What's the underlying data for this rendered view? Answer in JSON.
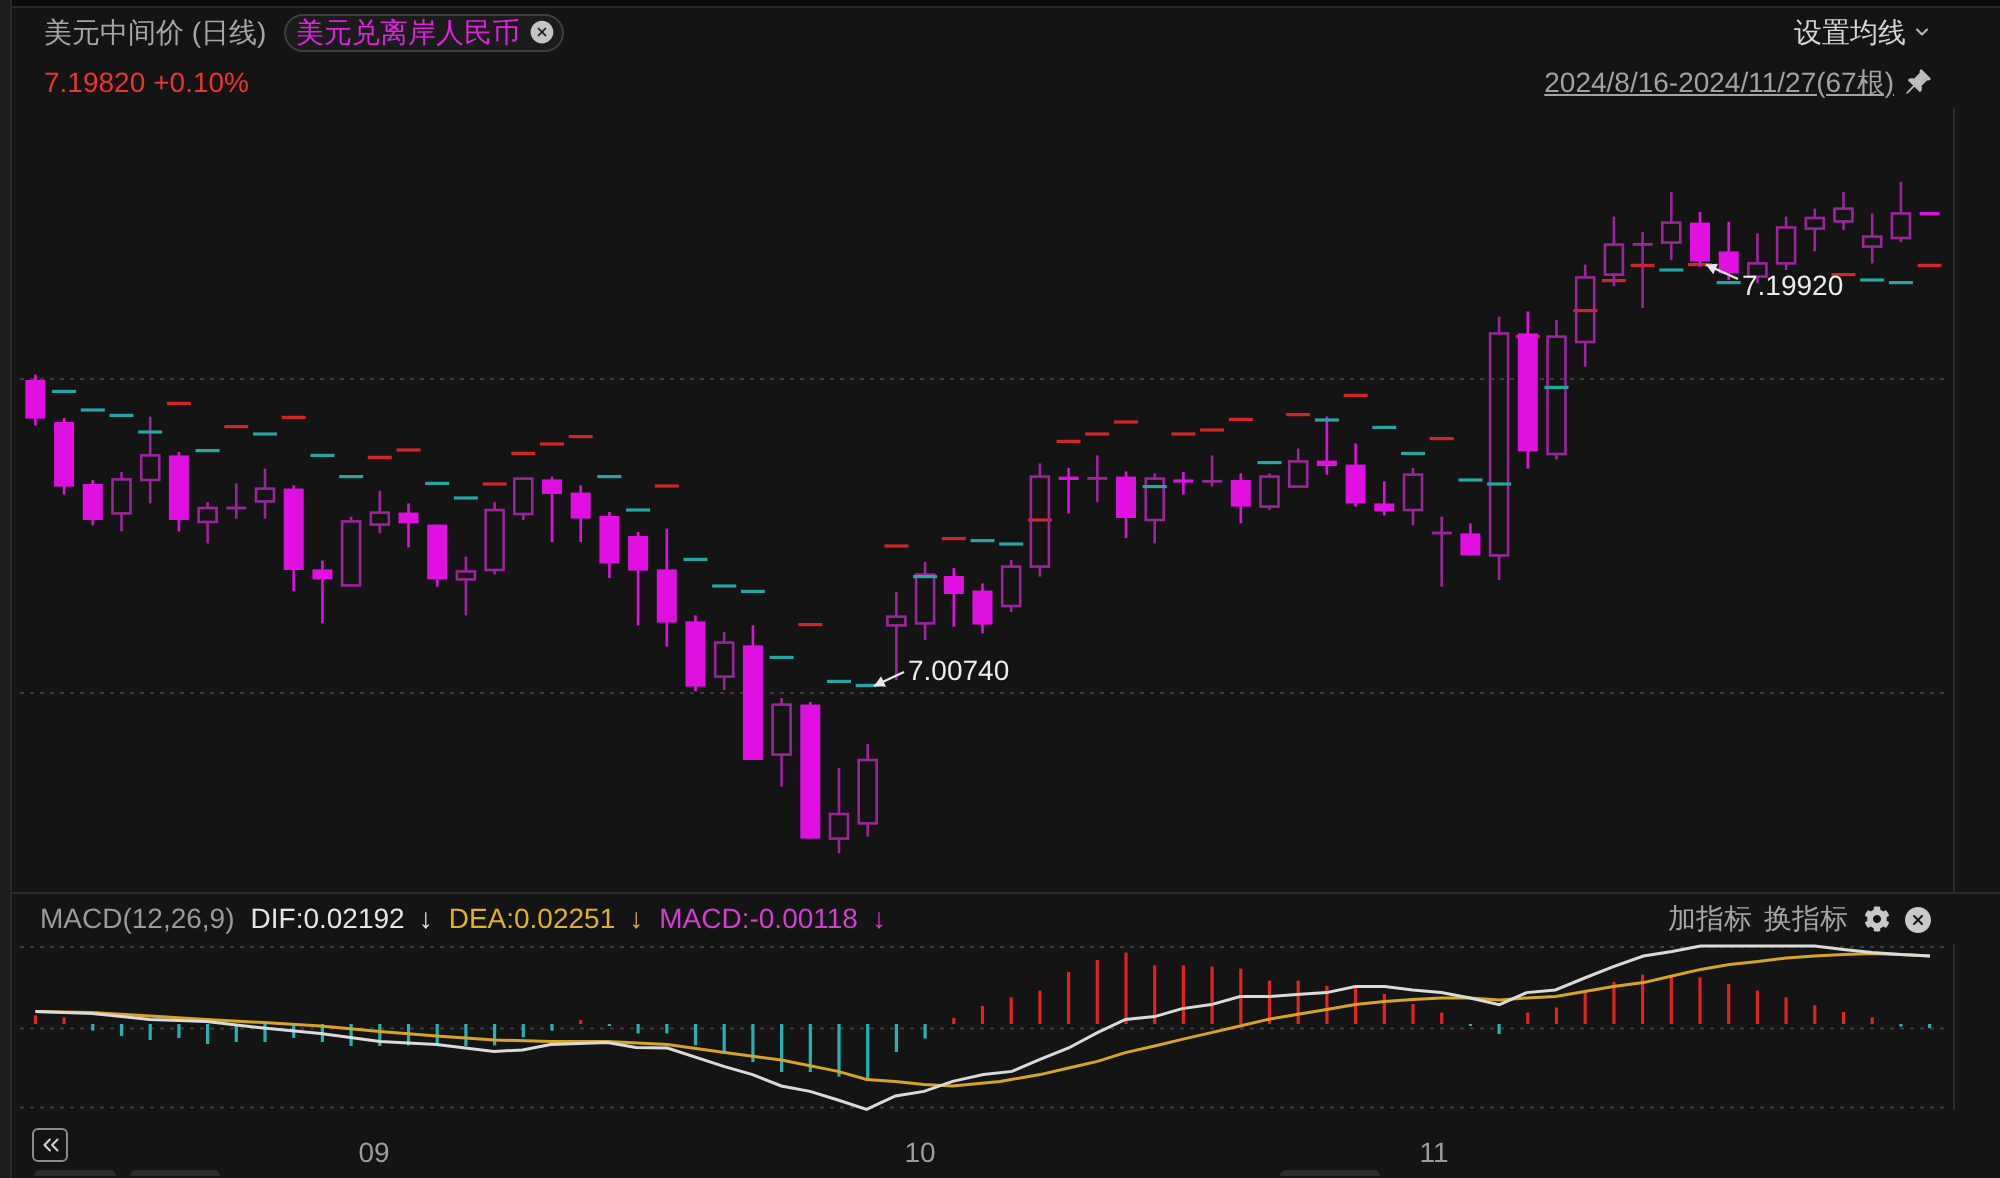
{
  "header": {
    "title": "美元中间价 (日线)",
    "compare_tag": {
      "label": "美元兑离岸人民币"
    },
    "ma_settings": {
      "label": "设置均线"
    },
    "price": "7.19820",
    "change": "+0.10%",
    "date_range": "2024/8/16-2024/11/27(67根)"
  },
  "chart": {
    "annotations": [
      {
        "label": "7.00740"
      },
      {
        "label": "7.19920"
      }
    ]
  },
  "macd_panel": {
    "title": "MACD(12,26,9)",
    "readings": [
      {
        "label": "DIF:0.02192",
        "arrow": "↓",
        "color": "#e6e6e6"
      },
      {
        "label": "DEA:0.02251",
        "arrow": "↓",
        "color": "#e2b126"
      },
      {
        "label": "MACD:-0.00118",
        "arrow": "↓",
        "color": "#d23fd2"
      }
    ],
    "buttons": [
      {
        "label": "加指标"
      },
      {
        "label": "换指标"
      }
    ],
    "x_axis_labels": [
      "09",
      "10",
      "11"
    ]
  }
}
